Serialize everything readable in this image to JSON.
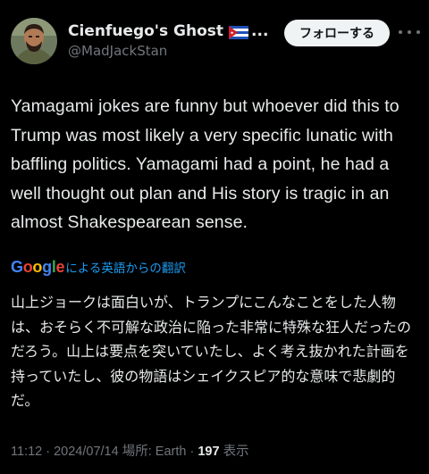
{
  "header": {
    "display_name": "Cienfuego's Ghost",
    "name_ellipsis": "...",
    "handle": "@MadJackStan",
    "follow_label": "フォローする",
    "flag_icon": "cuba-flag-icon",
    "more_icon": "more-options-icon"
  },
  "tweet": {
    "text": "Yamagami jokes are funny but whoever did this to Trump was most likely a very specific lunatic with baffling politics. Yamagami had a point, he had a well thought out plan and His story is tragic in an almost Shakespearean sense."
  },
  "translation": {
    "provider": "Google",
    "label": "による英語からの翻訳",
    "text": "山上ジョークは面白いが、トランプにこんなことをした人物は、おそらく不可解な政治に陥った非常に特殊な狂人だったのだろう。山上は要点を突いていたし、よく考え抜かれた計画を持っていたし、彼の物語はシェイクスピア的な意味で悲劇的だ。"
  },
  "meta": {
    "time": "11:12",
    "separator": " · ",
    "date": "2024/07/14",
    "location_label": "場所: Earth",
    "views_count": "197",
    "views_label": "表示"
  },
  "colors": {
    "background": "#000000",
    "text": "#e7e9ea",
    "secondary": "#71767b",
    "link": "#1d9bf0",
    "button_bg": "#eff3f4"
  }
}
